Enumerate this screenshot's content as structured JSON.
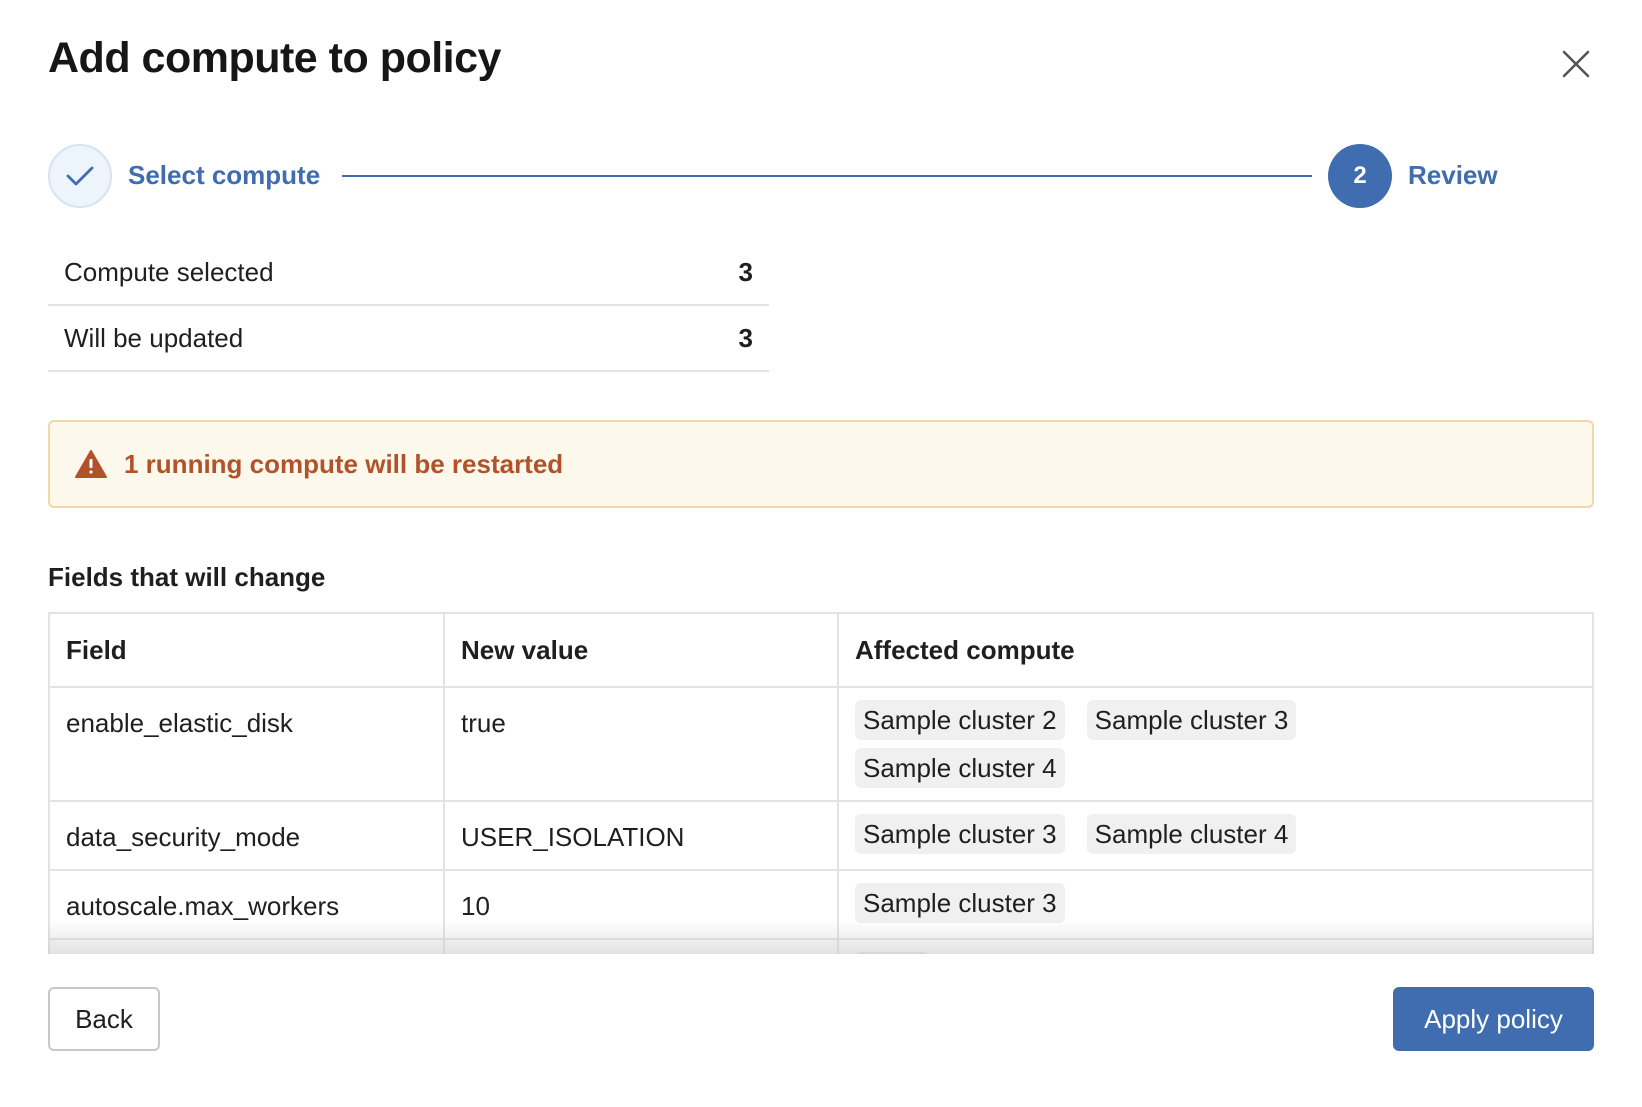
{
  "dialog": {
    "title": "Add compute to policy"
  },
  "stepper": {
    "steps": [
      {
        "label": "Select compute",
        "state": "complete"
      },
      {
        "label": "Review",
        "number": "2",
        "state": "active"
      }
    ]
  },
  "summary": {
    "rows": [
      {
        "label": "Compute selected",
        "value": "3"
      },
      {
        "label": "Will be updated",
        "value": "3"
      }
    ]
  },
  "warning": {
    "icon": "warning-triangle-icon",
    "text": "1 running compute will be restarted"
  },
  "fields": {
    "title": "Fields that will change",
    "columns": [
      "Field",
      "New value",
      "Affected compute"
    ],
    "rows": [
      {
        "field": "enable_elastic_disk",
        "value": "true",
        "compute": [
          "Sample cluster 2",
          "Sample cluster 3",
          "Sample cluster 4"
        ]
      },
      {
        "field": "data_security_mode",
        "value": "USER_ISOLATION",
        "compute": [
          "Sample cluster 3",
          "Sample cluster 4"
        ]
      },
      {
        "field": "autoscale.max_workers",
        "value": "10",
        "compute": [
          "Sample cluster 3"
        ]
      }
    ]
  },
  "footer": {
    "back_label": "Back",
    "apply_label": "Apply policy"
  },
  "colors": {
    "accent": "#3f6db0",
    "warning_text": "#b0532a",
    "warning_bg": "#fdf8ec"
  }
}
